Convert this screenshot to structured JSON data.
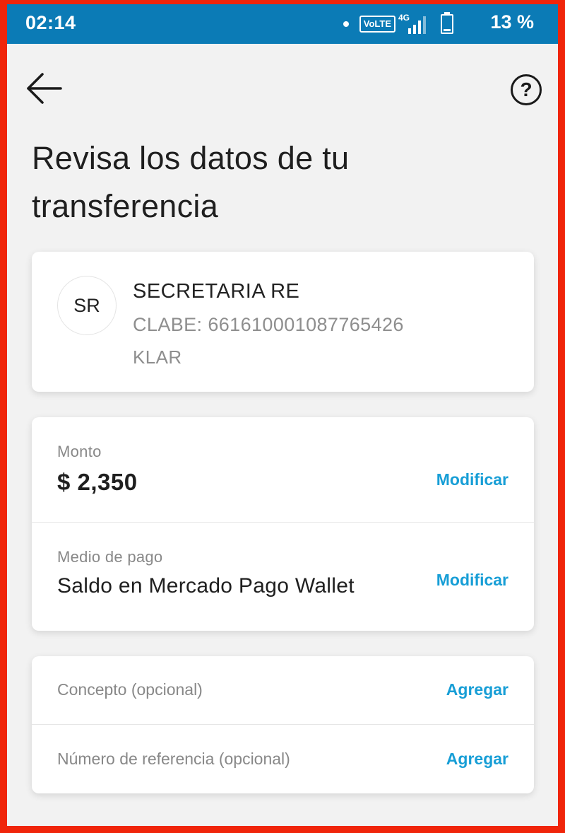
{
  "status_bar": {
    "time": "02:14",
    "volte": "VoLTE",
    "network": "4G",
    "battery_percent": "13 %",
    "battery_level": 0.13
  },
  "header": {
    "back_icon": "arrow-left-icon",
    "help_icon": "question-circle-icon",
    "help_symbol": "?"
  },
  "page": {
    "title": "Revisa los datos de tu transferencia"
  },
  "recipient": {
    "initials": "SR",
    "name": "SECRETARIA RE",
    "clabe": "CLABE: 661610001087765426",
    "bank": "KLAR"
  },
  "payment": {
    "amount_label": "Monto",
    "amount_value": "$ 2,350",
    "amount_action": "Modificar",
    "method_label": "Medio de pago",
    "method_value": "Saldo en Mercado Pago Wallet",
    "method_action": "Modificar"
  },
  "optional": {
    "concept_label": "Concepto (opcional)",
    "concept_action": "Agregar",
    "reference_label": "Número de referencia (opcional)",
    "reference_action": "Agregar"
  },
  "colors": {
    "status_bar": "#0b7bb6",
    "link": "#179ed6",
    "frame": "#f0250a",
    "background": "#f2f2f2"
  }
}
